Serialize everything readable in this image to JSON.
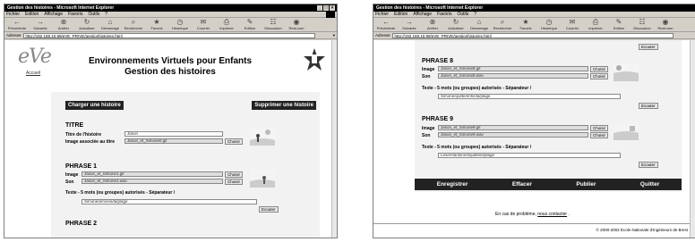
{
  "left_window": {
    "title": "Gestion des histoires - Microsoft Internet Explorer",
    "menu": [
      "Fichier",
      "Edition",
      "Affichage",
      "Favoris",
      "Outils",
      "?"
    ],
    "toolbar": [
      "Précédente",
      "Suivante",
      "Arrêter",
      "Actualiser",
      "Démarrage",
      "Rechercher",
      "Favoris",
      "Historique",
      "Courrier",
      "Imprimer",
      "Edition",
      "Discussion",
      "Real.com"
    ],
    "address_label": "Adresse",
    "address_value": "http://192.168.10.99/eVE_PRIVE/gestionhistoires.html",
    "logo_text": "eVe",
    "accueil_link": "Accueil",
    "title_line1": "Environnements Virtuels pour Enfants",
    "title_line2": "Gestion des histoires",
    "btn_charger": "Charger une histoire",
    "btn_supprimer": "Supprimer une histoire",
    "titre_heading": "TITRE",
    "titre_label": "Titre de l'histoire",
    "titre_value": "Jason",
    "image_assoc_label": "Image associée au titre",
    "image_assoc_value": "Jason_et_Simone0.gif",
    "choisir": "Choisir",
    "phrase1_heading": "PHRASE 1",
    "image_label": "Image",
    "son_label": "Son",
    "phrase1_image": "Jason_et_Simone1.gif",
    "phrase1_son": "Jason_et_Simone1.wav",
    "texte_label": "Texte - 5 mots (ou groupes) autorisés - Séparateur /",
    "phrase1_texte": "Simone/arrive/a/la/plage",
    "ecouter": "Ecouter",
    "phrase2_heading": "PHRASE 2"
  },
  "right_window": {
    "title": "Gestion des histoires - Microsoft Internet Explorer",
    "menu": [
      "Fichier",
      "Edition",
      "Affichage",
      "Favoris",
      "Outils",
      "?"
    ],
    "toolbar": [
      "Précédente",
      "Suivante",
      "Arrêter",
      "Actualiser",
      "Démarrage",
      "Rechercher",
      "Favoris",
      "Historique",
      "Courrier",
      "Imprimer",
      "Edition",
      "Discussion",
      "Real.com"
    ],
    "address_label": "Adresse",
    "address_value": "http://192.168.10.99/eVE_PRIVE/gestionhistoires.html",
    "ecouter": "Ecouter",
    "phrase8_heading": "PHRASE 8",
    "image_label": "Image",
    "son_label": "Son",
    "phrase8_image": "Jason_et_Simone8.gif",
    "phrase8_son": "Jason_et_Simone8.wav",
    "choisir": "Choisir",
    "texte_label": "Texte - 5 mots (ou groupes) autorisés - Séparateur /",
    "phrase8_texte": "Simone/quitte/enfin/la/plage",
    "phrase9_heading": "PHRASE 9",
    "phrase9_image": "Jason_et_Simone9.gif",
    "phrase9_son": "Jason_et_Simone9.wav",
    "phrase9_texte": "Les/enfants/ont/quitté/la/plage",
    "btn_enregistrer": "Enregistrer",
    "btn_effacer": "Effacer",
    "btn_publier": "Publier",
    "btn_quitter": "Quitter",
    "footer_text": "En cas de problème,",
    "footer_link": "nous contacter",
    "footer_end": ".",
    "copyright": "© 2000-2002 Ecole Nationale d'Ingénieurs de Brest"
  }
}
